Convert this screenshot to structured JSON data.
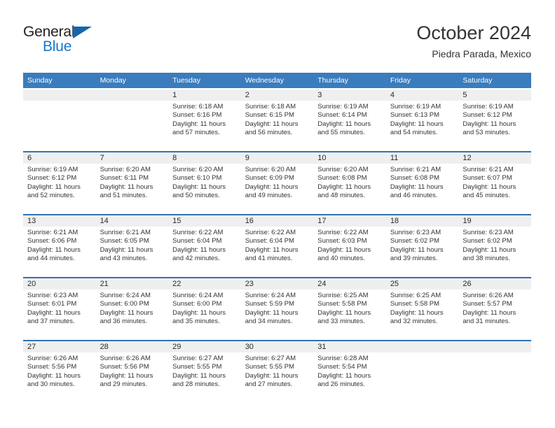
{
  "brand": {
    "name_top": "General",
    "name_bottom": "Blue",
    "triangle_color": "#1565b0",
    "blue_text_color": "#1578c8"
  },
  "header": {
    "title": "October 2024",
    "subtitle": "Piedra Parada, Mexico"
  },
  "theme": {
    "header_bg": "#3a7cbe",
    "row_separator": "#2e74b5",
    "daynum_bg": "#efefef",
    "text": "#333333"
  },
  "weekday_headers": [
    "Sunday",
    "Monday",
    "Tuesday",
    "Wednesday",
    "Thursday",
    "Friday",
    "Saturday"
  ],
  "weeks": [
    [
      {
        "day": "",
        "sunrise": "",
        "sunset": "",
        "daylight": "",
        "empty": true
      },
      {
        "day": "",
        "sunrise": "",
        "sunset": "",
        "daylight": "",
        "empty": true
      },
      {
        "day": "1",
        "sunrise": "Sunrise: 6:18 AM",
        "sunset": "Sunset: 6:16 PM",
        "daylight": "Daylight: 11 hours and 57 minutes."
      },
      {
        "day": "2",
        "sunrise": "Sunrise: 6:18 AM",
        "sunset": "Sunset: 6:15 PM",
        "daylight": "Daylight: 11 hours and 56 minutes."
      },
      {
        "day": "3",
        "sunrise": "Sunrise: 6:19 AM",
        "sunset": "Sunset: 6:14 PM",
        "daylight": "Daylight: 11 hours and 55 minutes."
      },
      {
        "day": "4",
        "sunrise": "Sunrise: 6:19 AM",
        "sunset": "Sunset: 6:13 PM",
        "daylight": "Daylight: 11 hours and 54 minutes."
      },
      {
        "day": "5",
        "sunrise": "Sunrise: 6:19 AM",
        "sunset": "Sunset: 6:12 PM",
        "daylight": "Daylight: 11 hours and 53 minutes."
      }
    ],
    [
      {
        "day": "6",
        "sunrise": "Sunrise: 6:19 AM",
        "sunset": "Sunset: 6:12 PM",
        "daylight": "Daylight: 11 hours and 52 minutes."
      },
      {
        "day": "7",
        "sunrise": "Sunrise: 6:20 AM",
        "sunset": "Sunset: 6:11 PM",
        "daylight": "Daylight: 11 hours and 51 minutes."
      },
      {
        "day": "8",
        "sunrise": "Sunrise: 6:20 AM",
        "sunset": "Sunset: 6:10 PM",
        "daylight": "Daylight: 11 hours and 50 minutes."
      },
      {
        "day": "9",
        "sunrise": "Sunrise: 6:20 AM",
        "sunset": "Sunset: 6:09 PM",
        "daylight": "Daylight: 11 hours and 49 minutes."
      },
      {
        "day": "10",
        "sunrise": "Sunrise: 6:20 AM",
        "sunset": "Sunset: 6:08 PM",
        "daylight": "Daylight: 11 hours and 48 minutes."
      },
      {
        "day": "11",
        "sunrise": "Sunrise: 6:21 AM",
        "sunset": "Sunset: 6:08 PM",
        "daylight": "Daylight: 11 hours and 46 minutes."
      },
      {
        "day": "12",
        "sunrise": "Sunrise: 6:21 AM",
        "sunset": "Sunset: 6:07 PM",
        "daylight": "Daylight: 11 hours and 45 minutes."
      }
    ],
    [
      {
        "day": "13",
        "sunrise": "Sunrise: 6:21 AM",
        "sunset": "Sunset: 6:06 PM",
        "daylight": "Daylight: 11 hours and 44 minutes."
      },
      {
        "day": "14",
        "sunrise": "Sunrise: 6:21 AM",
        "sunset": "Sunset: 6:05 PM",
        "daylight": "Daylight: 11 hours and 43 minutes."
      },
      {
        "day": "15",
        "sunrise": "Sunrise: 6:22 AM",
        "sunset": "Sunset: 6:04 PM",
        "daylight": "Daylight: 11 hours and 42 minutes."
      },
      {
        "day": "16",
        "sunrise": "Sunrise: 6:22 AM",
        "sunset": "Sunset: 6:04 PM",
        "daylight": "Daylight: 11 hours and 41 minutes."
      },
      {
        "day": "17",
        "sunrise": "Sunrise: 6:22 AM",
        "sunset": "Sunset: 6:03 PM",
        "daylight": "Daylight: 11 hours and 40 minutes."
      },
      {
        "day": "18",
        "sunrise": "Sunrise: 6:23 AM",
        "sunset": "Sunset: 6:02 PM",
        "daylight": "Daylight: 11 hours and 39 minutes."
      },
      {
        "day": "19",
        "sunrise": "Sunrise: 6:23 AM",
        "sunset": "Sunset: 6:02 PM",
        "daylight": "Daylight: 11 hours and 38 minutes."
      }
    ],
    [
      {
        "day": "20",
        "sunrise": "Sunrise: 6:23 AM",
        "sunset": "Sunset: 6:01 PM",
        "daylight": "Daylight: 11 hours and 37 minutes."
      },
      {
        "day": "21",
        "sunrise": "Sunrise: 6:24 AM",
        "sunset": "Sunset: 6:00 PM",
        "daylight": "Daylight: 11 hours and 36 minutes."
      },
      {
        "day": "22",
        "sunrise": "Sunrise: 6:24 AM",
        "sunset": "Sunset: 6:00 PM",
        "daylight": "Daylight: 11 hours and 35 minutes."
      },
      {
        "day": "23",
        "sunrise": "Sunrise: 6:24 AM",
        "sunset": "Sunset: 5:59 PM",
        "daylight": "Daylight: 11 hours and 34 minutes."
      },
      {
        "day": "24",
        "sunrise": "Sunrise: 6:25 AM",
        "sunset": "Sunset: 5:58 PM",
        "daylight": "Daylight: 11 hours and 33 minutes."
      },
      {
        "day": "25",
        "sunrise": "Sunrise: 6:25 AM",
        "sunset": "Sunset: 5:58 PM",
        "daylight": "Daylight: 11 hours and 32 minutes."
      },
      {
        "day": "26",
        "sunrise": "Sunrise: 6:26 AM",
        "sunset": "Sunset: 5:57 PM",
        "daylight": "Daylight: 11 hours and 31 minutes."
      }
    ],
    [
      {
        "day": "27",
        "sunrise": "Sunrise: 6:26 AM",
        "sunset": "Sunset: 5:56 PM",
        "daylight": "Daylight: 11 hours and 30 minutes."
      },
      {
        "day": "28",
        "sunrise": "Sunrise: 6:26 AM",
        "sunset": "Sunset: 5:56 PM",
        "daylight": "Daylight: 11 hours and 29 minutes."
      },
      {
        "day": "29",
        "sunrise": "Sunrise: 6:27 AM",
        "sunset": "Sunset: 5:55 PM",
        "daylight": "Daylight: 11 hours and 28 minutes."
      },
      {
        "day": "30",
        "sunrise": "Sunrise: 6:27 AM",
        "sunset": "Sunset: 5:55 PM",
        "daylight": "Daylight: 11 hours and 27 minutes."
      },
      {
        "day": "31",
        "sunrise": "Sunrise: 6:28 AM",
        "sunset": "Sunset: 5:54 PM",
        "daylight": "Daylight: 11 hours and 26 minutes."
      },
      {
        "day": "",
        "sunrise": "",
        "sunset": "",
        "daylight": "",
        "empty": true
      },
      {
        "day": "",
        "sunrise": "",
        "sunset": "",
        "daylight": "",
        "empty": true
      }
    ]
  ]
}
